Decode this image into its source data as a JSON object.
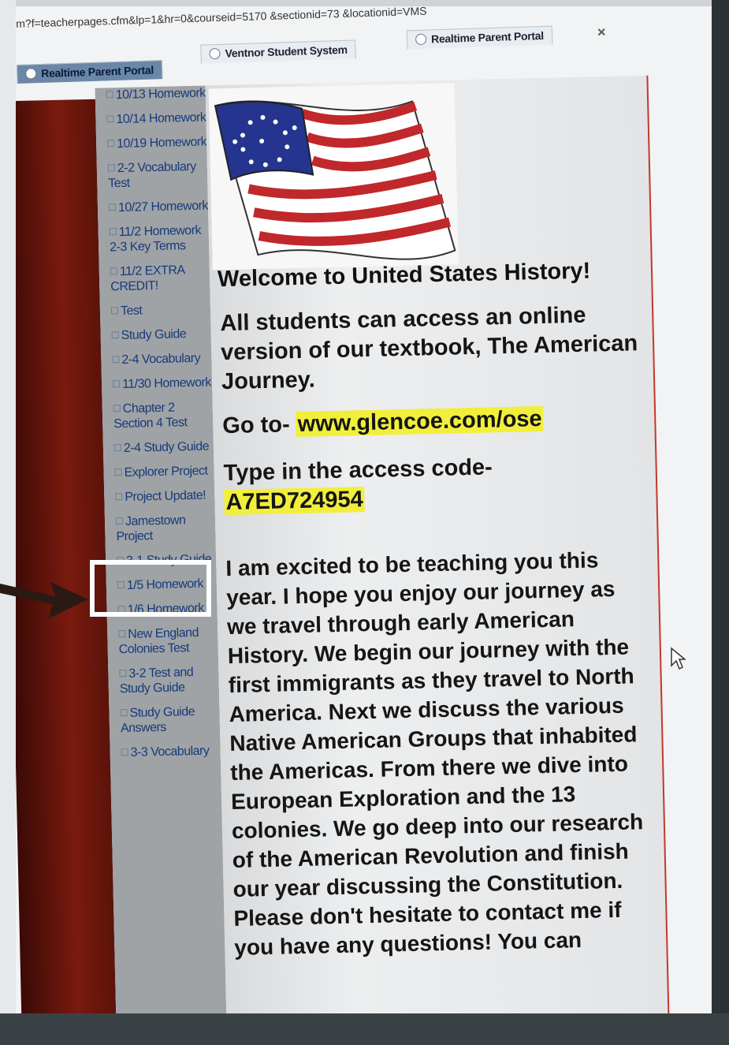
{
  "browser": {
    "url": "m?f=teacherpages.cfm&lp=1&hr=0&courseid=5170 &sectionid=73 &locationid=VMS",
    "tabs": [
      {
        "label": "Realtime Parent Portal",
        "active": true
      },
      {
        "label": "Ventnor Student System",
        "active": false
      },
      {
        "label": "Realtime Parent Portal",
        "active": false
      }
    ],
    "close_label": "×"
  },
  "sidebar": {
    "items": [
      "10/13 Homework",
      "10/14 Homework",
      "10/19 Homework",
      "2-2 Vocabulary Test",
      "10/27 Homework",
      "11/2 Homework 2-3 Key Terms",
      "11/2 EXTRA CREDIT!",
      "Test",
      "Study Guide",
      "2-4 Vocabulary",
      "11/30 Homework",
      "Chapter 2 Section 4 Test",
      "2-4 Study Guide",
      "Explorer Project",
      "Project Update!",
      "Jamestown Project",
      "3-1 Study Guide",
      "1/5 Homework",
      "1/6 Homework",
      "New England Colonies Test",
      "3-2 Test and Study Guide",
      "Study Guide Answers",
      "3-3 Vocabulary"
    ]
  },
  "main": {
    "heading": "Welcome to United States History!",
    "intro": "All students can access an online version of our textbook, The American Journey.",
    "goto_label": "Go to-",
    "goto_link": "www.glencoe.com/ose",
    "access_label": "Type in the access code-",
    "access_code": "A7ED724954",
    "body": "I am excited to be teaching you this year. I hope you enjoy our journey as we travel through early American History. We begin our journey with the first immigrants as they travel to North America. Next we discuss the various Native American Groups that inhabited the Americas. From there we dive into European Exploration and the 13 colonies. We go deep into our research of the American Revolution and finish our year discussing the Constitution. Please don't hesitate to contact me if you have any questions! You can"
  },
  "colors": {
    "accent_red": "#7a1a0e",
    "link_blue": "#173a7a",
    "highlight_yellow": "#f2ef3c"
  },
  "icons": [
    "browser-tab-icon",
    "flag-image",
    "expand-plus-icon",
    "arrow-pointer",
    "mouse-cursor-icon"
  ]
}
